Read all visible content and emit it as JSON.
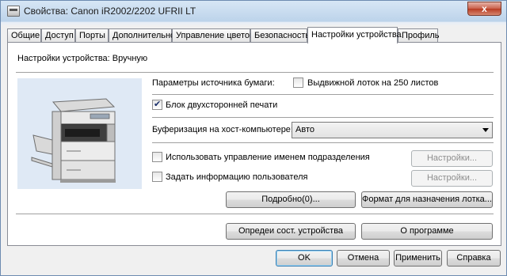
{
  "window": {
    "title": "Свойства: Canon iR2002/2202 UFRII LT",
    "close_glyph": "x"
  },
  "tabs": [
    {
      "label": "Общие"
    },
    {
      "label": "Доступ"
    },
    {
      "label": "Порты"
    },
    {
      "label": "Дополнительно"
    },
    {
      "label": "Управление цветом"
    },
    {
      "label": "Безопасность"
    },
    {
      "label": "Настройки устройства"
    },
    {
      "label": "Профиль"
    }
  ],
  "active_tab": "Настройки устройства",
  "panel": {
    "mode_text": "Настройки устройства: Вручную",
    "paper_source_label": "Параметры источника бумаги:",
    "drawer_option": {
      "label": "Выдвижной лоток на 250 листов",
      "checked": false
    },
    "duplex_option": {
      "label": "Блок двухсторонней печати",
      "checked": true
    },
    "spooling_label": "Буферизация на хост-компьютере:",
    "spooling_value": "Авто",
    "dept_id": {
      "label": "Использовать управление именем подразделения",
      "checked": false,
      "settings_label": "Настройки..."
    },
    "user_info": {
      "label": "Задать информацию пользователя",
      "checked": false,
      "settings_label": "Настройки..."
    },
    "details_button": "Подробно(0)...",
    "tray_format_button": "Формат для назначения лотка...",
    "get_status_button": "Опредеи сост. устройства",
    "about_button": "О программе"
  },
  "footer": {
    "ok": "OK",
    "cancel": "Отмена",
    "apply": "Применить",
    "help": "Справка"
  }
}
